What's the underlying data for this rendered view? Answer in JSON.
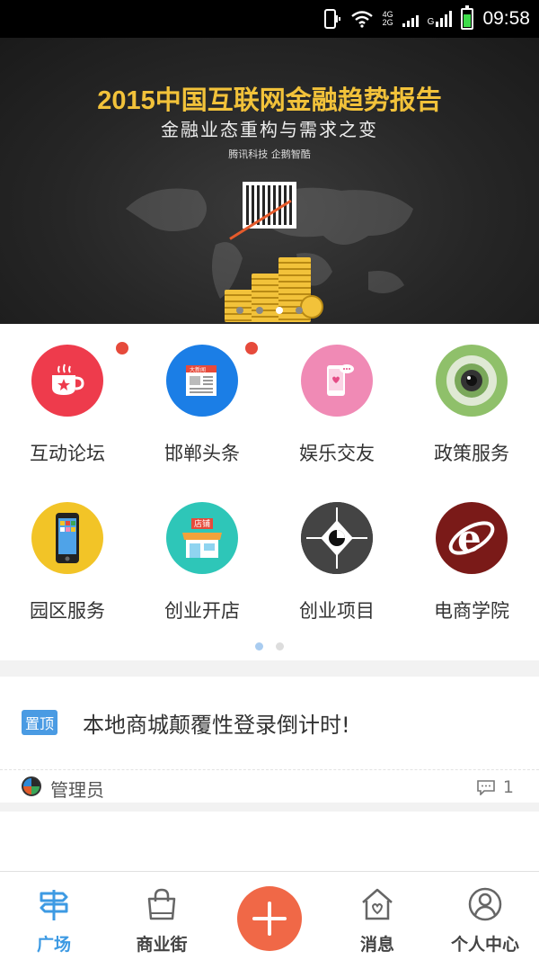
{
  "status_bar": {
    "time": "09:58",
    "network_top": "4G",
    "network_bottom": "2G",
    "g_label": "G"
  },
  "banner": {
    "title": "2015中国互联网金融趋势报告",
    "subtitle": "金融业态重构与需求之变",
    "logos": "腾讯科技  企鹅智酷",
    "slides_total": 4,
    "active_slide": 3
  },
  "grid": {
    "items": [
      {
        "label": "互动论坛",
        "icon": "coffee-cup-icon",
        "color": "#ee3b4c",
        "badge": true
      },
      {
        "label": "邯郸头条",
        "icon": "newspaper-icon",
        "color": "#1b7ee6",
        "badge": true
      },
      {
        "label": "娱乐交友",
        "icon": "phone-hearts-icon",
        "color": "#f08ab5",
        "badge": false
      },
      {
        "label": "政策服务",
        "icon": "camera-lens-icon",
        "color": "#8fc06a",
        "badge": false
      },
      {
        "label": "园区服务",
        "icon": "smartphone-icon",
        "color": "#f2c427",
        "badge": false
      },
      {
        "label": "创业开店",
        "icon": "storefront-icon",
        "color": "#2ec6b8",
        "badge": false
      },
      {
        "label": "创业项目",
        "icon": "aperture-icon",
        "color": "#444444",
        "badge": false
      },
      {
        "label": "电商学院",
        "icon": "ie-browser-icon",
        "color": "#7a1a18",
        "badge": false
      }
    ],
    "shop_sign": "店铺",
    "news_sign": "大新闻",
    "pages_total": 2,
    "active_page": 1
  },
  "post": {
    "tag": "置顶",
    "title": "本地商城颠覆性登录倒计时!",
    "author": "管理员",
    "comment_count": "1"
  },
  "nav": {
    "items": [
      {
        "label": "广场",
        "icon": "signpost-icon",
        "active": true
      },
      {
        "label": "商业街",
        "icon": "shopping-bag-icon",
        "active": false
      },
      {
        "label": "",
        "icon": "plus-icon",
        "active": false
      },
      {
        "label": "消息",
        "icon": "house-heart-icon",
        "active": false
      },
      {
        "label": "个人中心",
        "icon": "user-icon",
        "active": false
      }
    ]
  },
  "colors": {
    "accent": "#3d9ae3",
    "plus_button": "#f06847",
    "badge": "#e64a3b",
    "banner_title": "#f2c23a"
  }
}
